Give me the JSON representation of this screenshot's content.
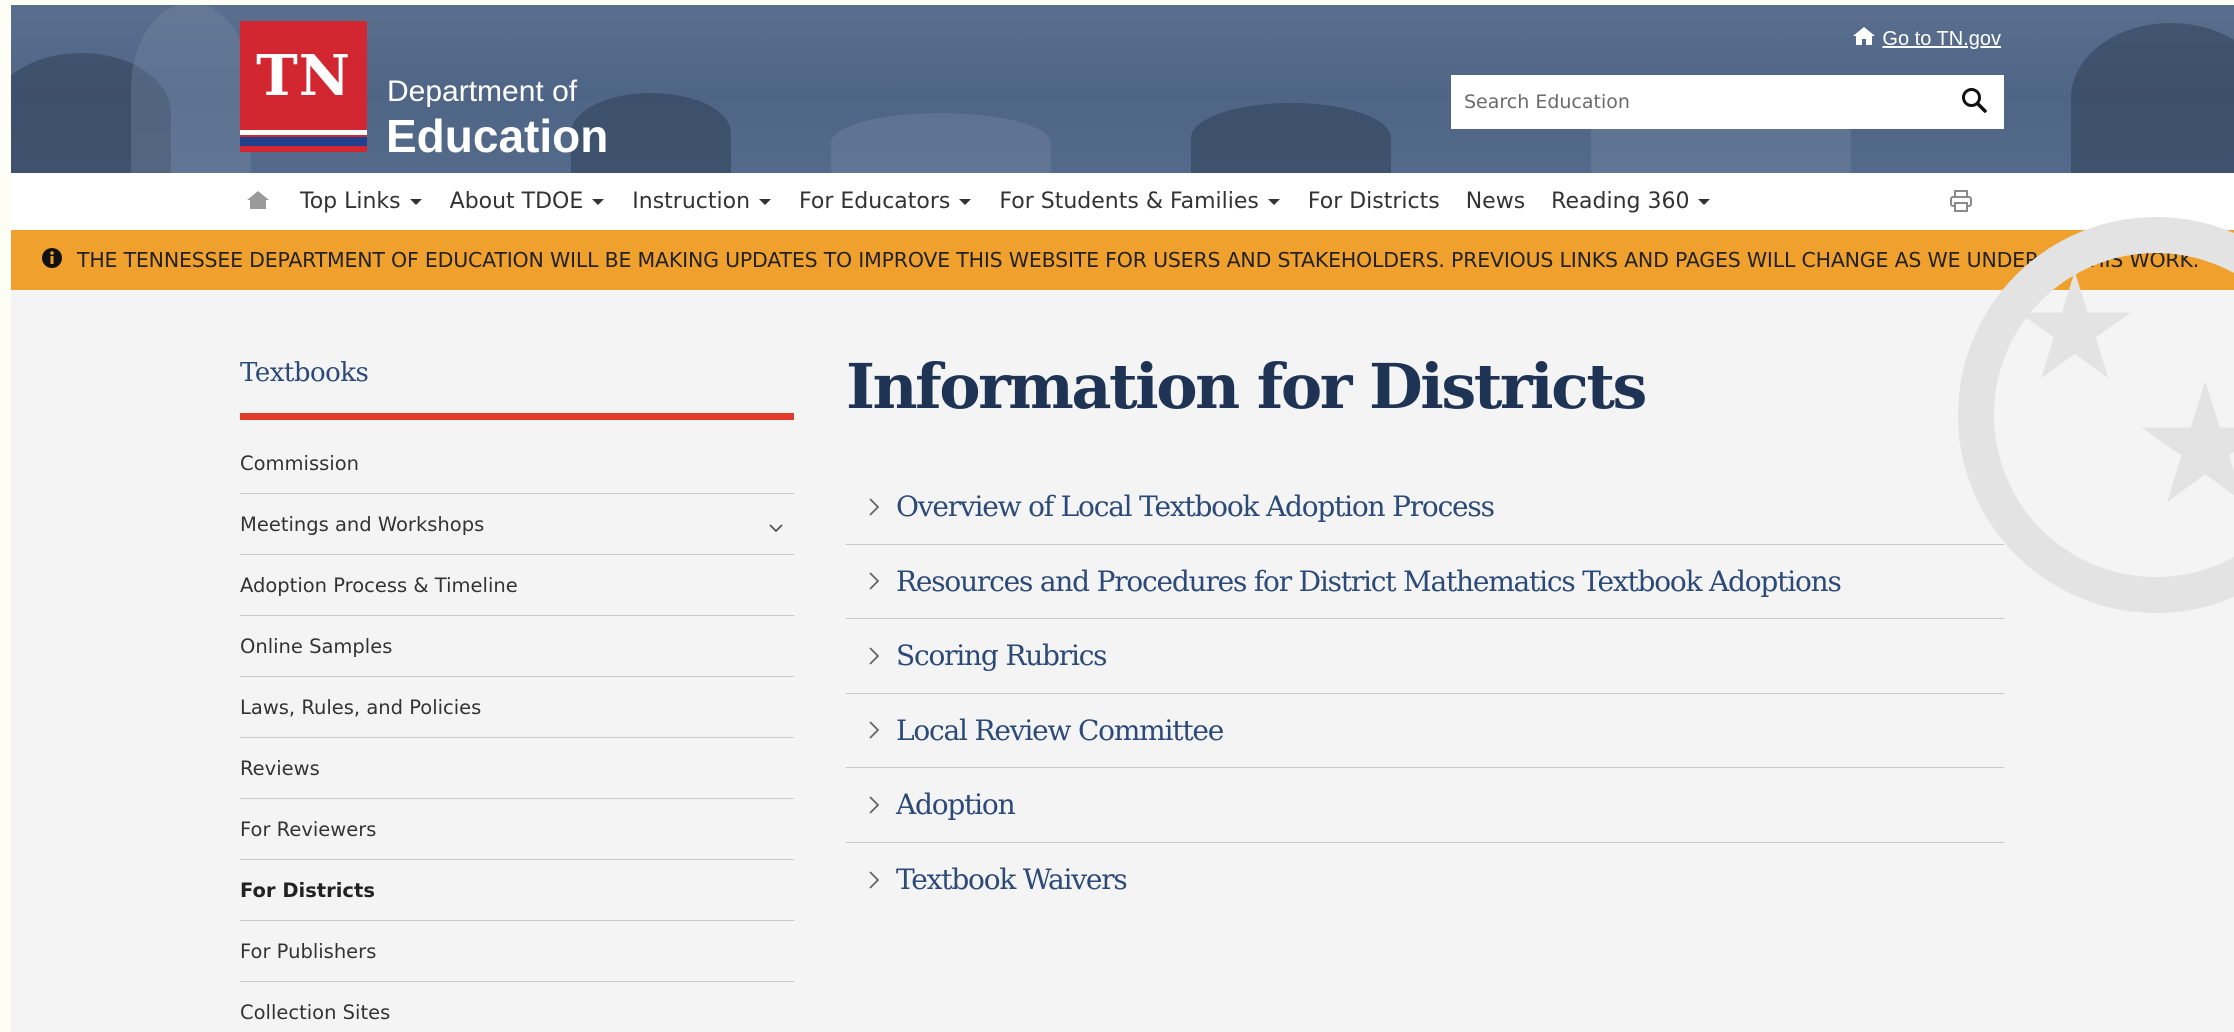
{
  "header": {
    "logo_mark": "TN",
    "logo_line1": "Department of",
    "logo_line2": "Education",
    "go_to_label": "Go to TN.gov",
    "search_placeholder": "Search Education"
  },
  "nav": {
    "items": [
      {
        "label": "Top Links",
        "dropdown": true
      },
      {
        "label": "About TDOE",
        "dropdown": true
      },
      {
        "label": "Instruction",
        "dropdown": true
      },
      {
        "label": "For Educators",
        "dropdown": true
      },
      {
        "label": "For Students & Families",
        "dropdown": true
      },
      {
        "label": "For Districts",
        "dropdown": false
      },
      {
        "label": "News",
        "dropdown": false
      },
      {
        "label": "Reading 360",
        "dropdown": true
      }
    ]
  },
  "alert": {
    "text": "THE TENNESSEE DEPARTMENT OF EDUCATION WILL BE MAKING UPDATES TO IMPROVE THIS WEBSITE FOR USERS AND STAKEHOLDERS. PREVIOUS LINKS AND PAGES WILL CHANGE AS WE UNDERGO THIS WORK."
  },
  "sidebar": {
    "title": "Textbooks",
    "items": [
      {
        "label": "Commission"
      },
      {
        "label": "Meetings and Workshops"
      },
      {
        "label": "Adoption Process & Timeline"
      },
      {
        "label": "Online Samples"
      },
      {
        "label": "Laws, Rules, and Policies"
      },
      {
        "label": "Reviews"
      },
      {
        "label": "For Reviewers"
      },
      {
        "label": "For Districts"
      },
      {
        "label": "For Publishers"
      },
      {
        "label": "Collection Sites"
      }
    ]
  },
  "main": {
    "title": "Information for Districts",
    "accordion": [
      {
        "label": "Overview of Local Textbook Adoption Process"
      },
      {
        "label": "Resources and Procedures for District Mathematics Textbook Adoptions"
      },
      {
        "label": "Scoring Rubrics"
      },
      {
        "label": "Local Review Committee"
      },
      {
        "label": "Adoption"
      },
      {
        "label": "Textbook Waivers"
      }
    ]
  },
  "colors": {
    "header_bg": "#536a8a",
    "logo_red": "#d22630",
    "alert_orange": "#f0a02c",
    "heading_navy": "#1f3455",
    "link_blue": "#2c4a78",
    "sidebar_accent": "#e13b2a"
  }
}
